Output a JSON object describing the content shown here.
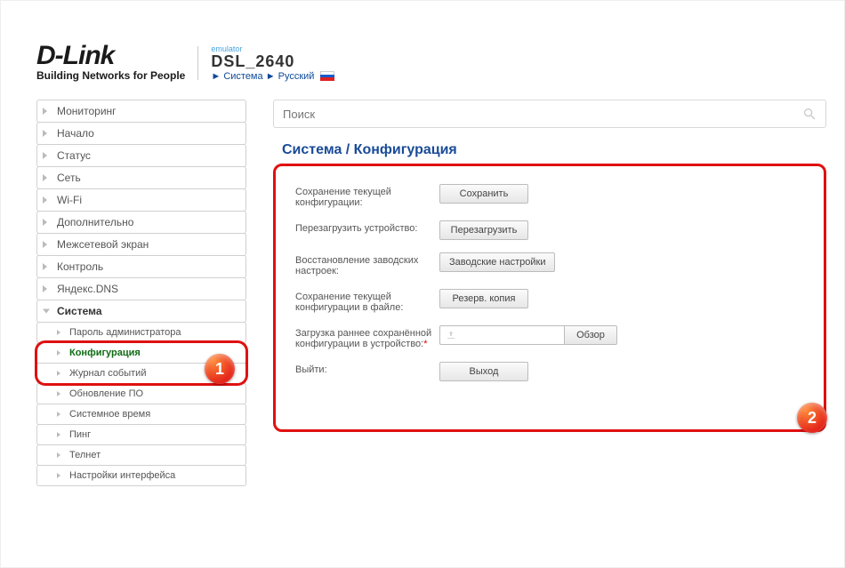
{
  "header": {
    "brand": "D-Link",
    "tagline": "Building Networks for People",
    "emulator_label": "emulator",
    "model": "DSL_2640",
    "crumb_arrow": "►",
    "crumb_system": "Система",
    "crumb_lang": "Русский"
  },
  "search": {
    "placeholder": "Поиск"
  },
  "sidebar": {
    "items": [
      {
        "label": "Мониторинг"
      },
      {
        "label": "Начало"
      },
      {
        "label": "Статус"
      },
      {
        "label": "Сеть"
      },
      {
        "label": "Wi-Fi"
      },
      {
        "label": "Дополнительно"
      },
      {
        "label": "Межсетевой экран"
      },
      {
        "label": "Контроль"
      },
      {
        "label": "Яндекс.DNS"
      },
      {
        "label": "Система"
      }
    ],
    "subitems": [
      {
        "label": "Пароль администратора"
      },
      {
        "label": "Конфигурация",
        "active": true
      },
      {
        "label": "Журнал событий"
      },
      {
        "label": "Обновление ПО"
      },
      {
        "label": "Системное время"
      },
      {
        "label": "Пинг"
      },
      {
        "label": "Телнет"
      },
      {
        "label": "Настройки интерфейса"
      }
    ]
  },
  "page": {
    "title": "Система / Конфигурация"
  },
  "form": {
    "rows": [
      {
        "label": "Сохранение текущей конфигурации:",
        "button": "Сохранить"
      },
      {
        "label": "Перезагрузить устройство:",
        "button": "Перезагрузить"
      },
      {
        "label": "Восстановление заводских настроек:",
        "button": "Заводские настройки"
      },
      {
        "label": "Сохранение текущей конфигурации в файле:",
        "button": "Резерв. копия"
      },
      {
        "label": "Загрузка раннее сохранённой конфигурации в устройство:",
        "required": true,
        "upload": true,
        "button": "Обзор"
      },
      {
        "label": "Выйти:",
        "button": "Выход"
      }
    ]
  },
  "callouts": {
    "one": "1",
    "two": "2"
  }
}
